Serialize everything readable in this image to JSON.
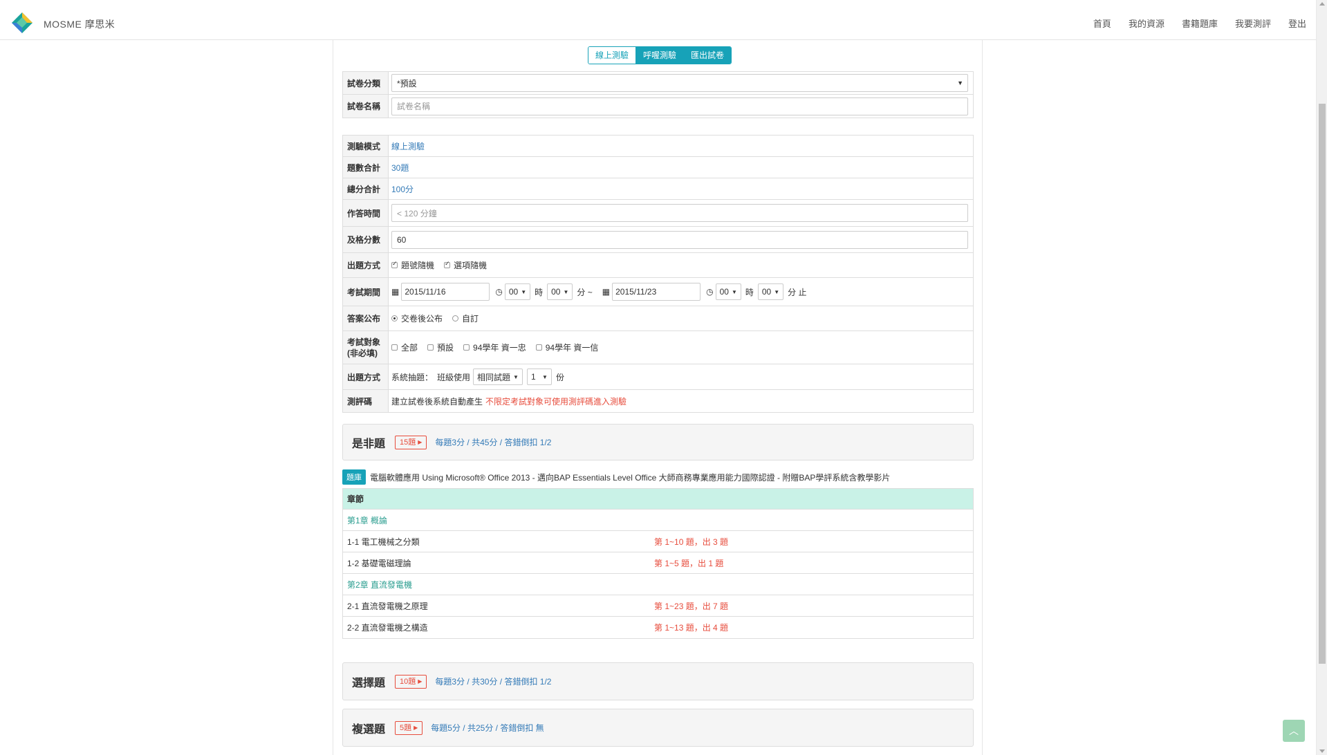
{
  "header": {
    "brand": "MOSME 摩思米",
    "nav": [
      "首頁",
      "我的資源",
      "書籍題庫",
      "我要測評",
      "登出"
    ]
  },
  "mode_tabs": [
    {
      "label": "線上測驗",
      "active": false
    },
    {
      "label": "呼喔測驗",
      "active": true
    },
    {
      "label": "匯出試卷",
      "active": true
    }
  ],
  "form1": {
    "category_label": "試卷分類",
    "category_value": "*預設",
    "name_label": "試卷名稱",
    "name_placeholder": "試卷名稱"
  },
  "form2": {
    "mode_label": "測驗模式",
    "mode_value": "線上測驗",
    "count_label": "題數合計",
    "count_value": "30題",
    "score_label": "總分合計",
    "score_value": "100分",
    "time_label": "作答時間",
    "time_placeholder": "< 120 分鐘",
    "pass_label": "及格分數",
    "pass_value": "60",
    "method_label": "出題方式",
    "method_opt1": "題號隨機",
    "method_opt2": "選項隨機",
    "period_label": "考試期間",
    "start_date": "2015/11/16",
    "start_hour": "00",
    "start_min": "00",
    "hour_unit": "時",
    "min_unit": "分 ~",
    "end_date": "2015/11/23",
    "end_hour": "00",
    "end_min": "00",
    "end_suffix": "分 止",
    "answer_label": "答案公布",
    "answer_opt1": "交卷後公布",
    "answer_opt2": "自訂",
    "target_label_1": "考試對象",
    "target_label_2": "(非必填)",
    "target_opts": [
      "全部",
      "預設",
      "94學年 資一忠",
      "94學年 資一信"
    ],
    "method2_label": "出題方式",
    "method2_prefix": "系統抽題：",
    "method2_class": "班級使用",
    "method2_select": "相同試題",
    "method2_num": "1",
    "method2_unit": "份",
    "code_label": "測評碼",
    "code_text": "建立試卷後系統自動產生",
    "code_note": "不限定考試對象可使用測評碼進入測驗"
  },
  "sections": [
    {
      "title": "是非題",
      "badge": "15題",
      "info": "每題3分 / 共45分 / 答錯倒扣 1/2"
    },
    {
      "title": "選擇題",
      "badge": "10題",
      "info": "每題3分 / 共30分 / 答錯倒扣 1/2"
    },
    {
      "title": "複選題",
      "badge": "5題",
      "info": "每題5分 / 共25分 / 答錯倒扣 無"
    }
  ],
  "book": {
    "badge": "題庫",
    "title": "電腦軟體應用 Using Microsoft® Office 2013 - 邁向BAP Essentials Level Office 大師商務專業應用能力國際認證 - 附贈BAP學評系統含教學影片"
  },
  "chapters": {
    "header": "章節",
    "rows": [
      {
        "name": "第1章 概論",
        "range": "",
        "type": "chapter"
      },
      {
        "name": "1-1 電工機械之分類",
        "range": "第 1~10 題，出 3 題",
        "type": "item"
      },
      {
        "name": "1-2 基礎電磁理論",
        "range": "第 1~5 題，出 1 題",
        "type": "item"
      },
      {
        "name": "第2章 直流發電機",
        "range": "",
        "type": "chapter"
      },
      {
        "name": "2-1 直流發電機之原理",
        "range": "第 1~23 題，出 7 題",
        "type": "item"
      },
      {
        "name": "2-2 直流發電機之構造",
        "range": "第 1~13 題，出 4 題",
        "type": "item"
      }
    ]
  },
  "colors": {
    "accent": "#17a2b8",
    "danger": "#e74c3c",
    "link": "#337ab7",
    "chapter_header": "#c9f2e7"
  }
}
